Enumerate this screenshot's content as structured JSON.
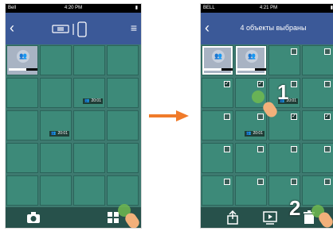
{
  "left_screen": {
    "status": {
      "carrier": "Bell",
      "time": "4:20 PM"
    },
    "toolbar": {
      "camera_icon": "camera-icon",
      "multiselect_icon": "multiselect-icon"
    },
    "thumb_icon": "👥",
    "grid": [
      {
        "type": "thumb"
      },
      {
        "type": "empty"
      },
      {
        "type": "empty"
      },
      {
        "type": "empty"
      },
      {
        "type": "empty"
      },
      {
        "type": "empty"
      },
      {
        "type": "video",
        "duration": "20:01"
      },
      {
        "type": "empty"
      },
      {
        "type": "empty"
      },
      {
        "type": "video",
        "duration": "20:01"
      },
      {
        "type": "empty"
      },
      {
        "type": "empty"
      },
      {
        "type": "empty"
      },
      {
        "type": "empty"
      },
      {
        "type": "empty"
      },
      {
        "type": "empty"
      },
      {
        "type": "empty"
      },
      {
        "type": "empty"
      },
      {
        "type": "empty"
      },
      {
        "type": "empty"
      }
    ]
  },
  "right_screen": {
    "status": {
      "carrier": "BELL",
      "time": "4:21 PM"
    },
    "title": "4 объекты выбраны",
    "grid": [
      {
        "type": "thumb",
        "selected": true
      },
      {
        "type": "thumb",
        "selected": true
      },
      {
        "type": "empty",
        "checked": false
      },
      {
        "type": "empty",
        "checked": false
      },
      {
        "type": "empty",
        "checked": true
      },
      {
        "type": "empty",
        "checked": true
      },
      {
        "type": "video",
        "duration": "20:01",
        "checked": false
      },
      {
        "type": "empty",
        "checked": false
      },
      {
        "type": "empty",
        "checked": false
      },
      {
        "type": "video",
        "duration": "20:01",
        "checked": false
      },
      {
        "type": "empty",
        "checked": true
      },
      {
        "type": "empty",
        "checked": true
      },
      {
        "type": "empty",
        "checked": false
      },
      {
        "type": "empty",
        "checked": false
      },
      {
        "type": "empty",
        "checked": false
      },
      {
        "type": "empty",
        "checked": false
      },
      {
        "type": "empty",
        "checked": false
      },
      {
        "type": "empty",
        "checked": false
      },
      {
        "type": "empty",
        "checked": false
      },
      {
        "type": "empty",
        "checked": false
      }
    ],
    "toolbar": {
      "share_icon": "share-icon",
      "slideshow_icon": "slideshow-icon",
      "trash_icon": "trash-icon"
    }
  },
  "annotations": {
    "step1": "1",
    "step2": "2"
  },
  "colors": {
    "navbar": "#3b5998",
    "grid_bg": "#3e7a70",
    "arrow": "#f07b2a"
  }
}
